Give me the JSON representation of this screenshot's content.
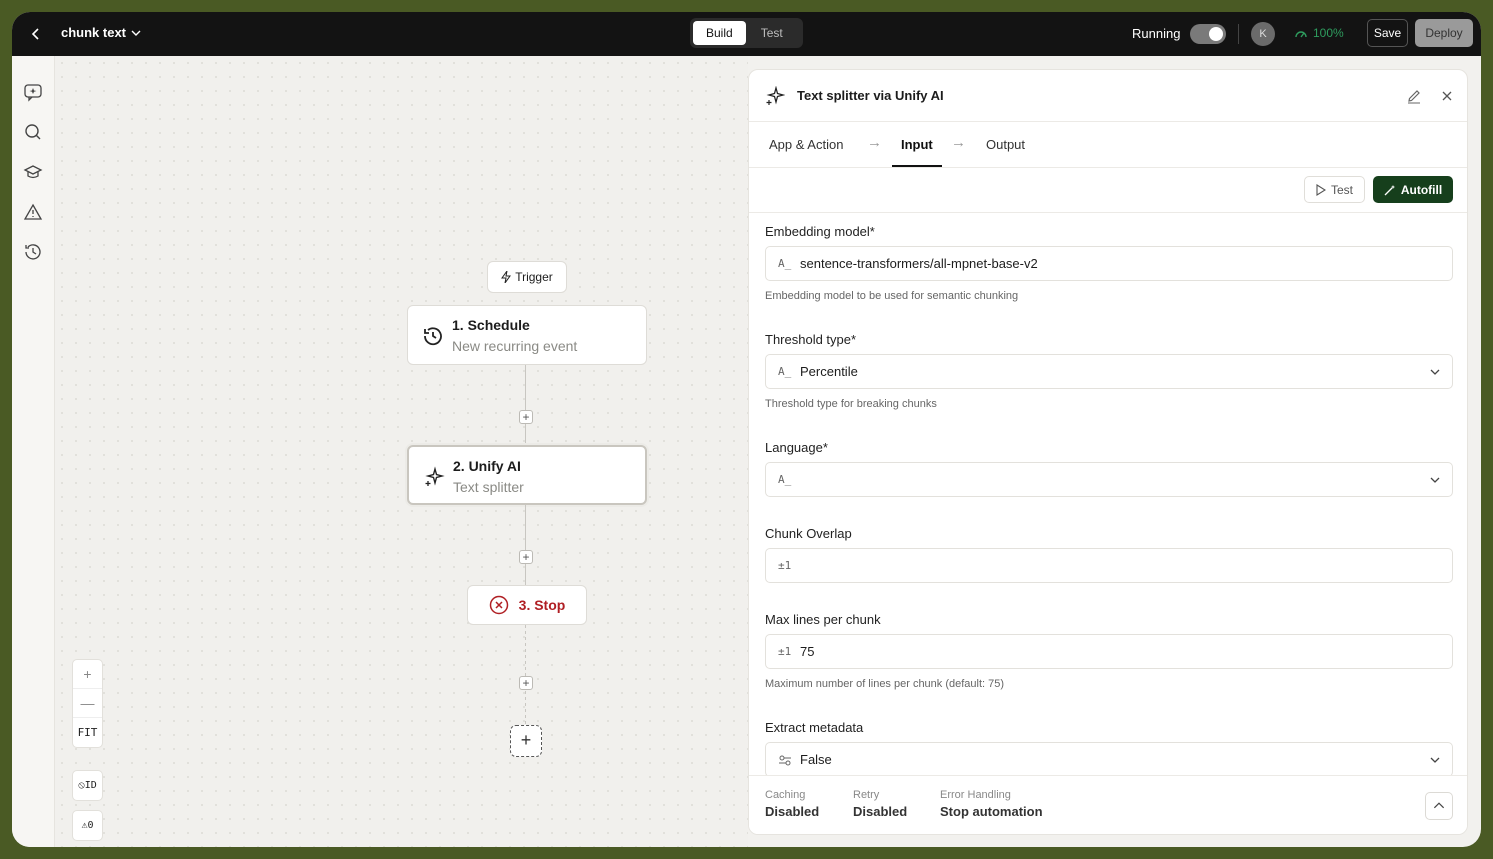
{
  "topbar": {
    "workflow_name": "chunk text",
    "modes": [
      "Build",
      "Test"
    ],
    "active_mode": "Build",
    "running_label": "Running",
    "avatar_initial": "K",
    "health": "100%",
    "save_label": "Save",
    "deploy_label": "Deploy"
  },
  "sidebar": {
    "icons": [
      "sparkle-chat-icon",
      "search-icon",
      "graduation-cap-icon",
      "warning-icon",
      "history-icon"
    ]
  },
  "canvas": {
    "trigger_label": "Trigger",
    "steps": [
      {
        "title": "1. Schedule",
        "subtitle": "New recurring event",
        "icon": "clock-refresh-icon"
      },
      {
        "title": "2. Unify AI",
        "subtitle": "Text splitter",
        "icon": "sparkles-icon"
      }
    ],
    "stop_label": "3. Stop",
    "zoom_controls": [
      "+",
      "—",
      "FIT"
    ],
    "id_toggle": "ID",
    "warnings_count": "0"
  },
  "panel": {
    "title": "Text splitter via Unify AI",
    "tabs": [
      "App & Action",
      "Input",
      "Output"
    ],
    "active_tab": "Input",
    "test_label": "Test",
    "autofill_label": "Autofill",
    "fields": {
      "embedding": {
        "label": "Embedding model*",
        "value": "sentence-transformers/all-mpnet-base-v2",
        "help": "Embedding model to be used for semantic chunking"
      },
      "threshold": {
        "label": "Threshold type*",
        "value": "Percentile",
        "help": "Threshold type for breaking chunks"
      },
      "language": {
        "label": "Language*",
        "value": ""
      },
      "overlap": {
        "label": "Chunk Overlap",
        "value": ""
      },
      "max_lines": {
        "label": "Max lines per chunk",
        "value": "75",
        "help": "Maximum number of lines per chunk (default: 75)"
      },
      "metadata": {
        "label": "Extract metadata",
        "value": "False"
      }
    },
    "footer": {
      "caching_label": "Caching",
      "caching_value": "Disabled",
      "retry_label": "Retry",
      "retry_value": "Disabled",
      "error_label": "Error Handling",
      "error_value": "Stop automation"
    }
  },
  "colors": {
    "frame_bg": "#4a5a24",
    "topbar": "#131313",
    "accent_green": "#163f1c",
    "stop_red": "#b01f24",
    "health_green": "#2e9c5e"
  }
}
